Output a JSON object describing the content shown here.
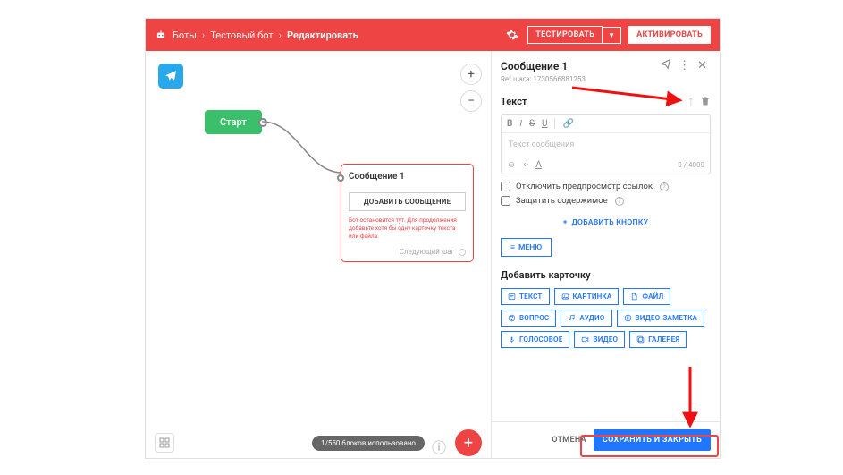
{
  "header": {
    "breadcrumb1": "Боты",
    "breadcrumb2": "Тестовый бот",
    "current": "Редактировать",
    "test_btn": "ТЕСТИРОВАТЬ",
    "activate_btn": "АКТИВИРОВАТЬ"
  },
  "canvas": {
    "start_label": "Старт",
    "msg_title": "Сообщение 1",
    "add_msg_btn": "ДОБАВИТЬ СООБЩЕНИЕ",
    "warn_text": "Бот остановится тут. Для продолжения добавьте хотя бы одну карточку текста или файла.",
    "next_step": "Следующий шаг",
    "blocks_used": "1/550 блоков использовано"
  },
  "panel": {
    "title": "Сообщение 1",
    "ref_label": "Ref шага:",
    "ref_value": "1730566881253",
    "text_section": "Текст",
    "placeholder": "Текст сообщения",
    "counter": "0 / 4000",
    "chk_preview": "Отключить предпросмотр ссылок",
    "chk_protect": "Защитить содержимое",
    "add_button": "ДОБАВИТЬ КНОПКУ",
    "menu_btn": "МЕНЮ",
    "add_card_title": "Добавить карточку",
    "cards": {
      "text": "ТЕКСТ",
      "image": "КАРТИНКА",
      "file": "ФАЙЛ",
      "question": "ВОПРОС",
      "audio": "АУДИО",
      "videonote": "ВИДЕО-ЗАМЕТКА",
      "voice": "ГОЛОСОВОЕ",
      "video": "ВИДЕО",
      "gallery": "ГАЛЕРЕЯ"
    },
    "cancel": "ОТМЕНА",
    "save": "СОХРАНИТЬ И ЗАКРЫТЬ"
  }
}
